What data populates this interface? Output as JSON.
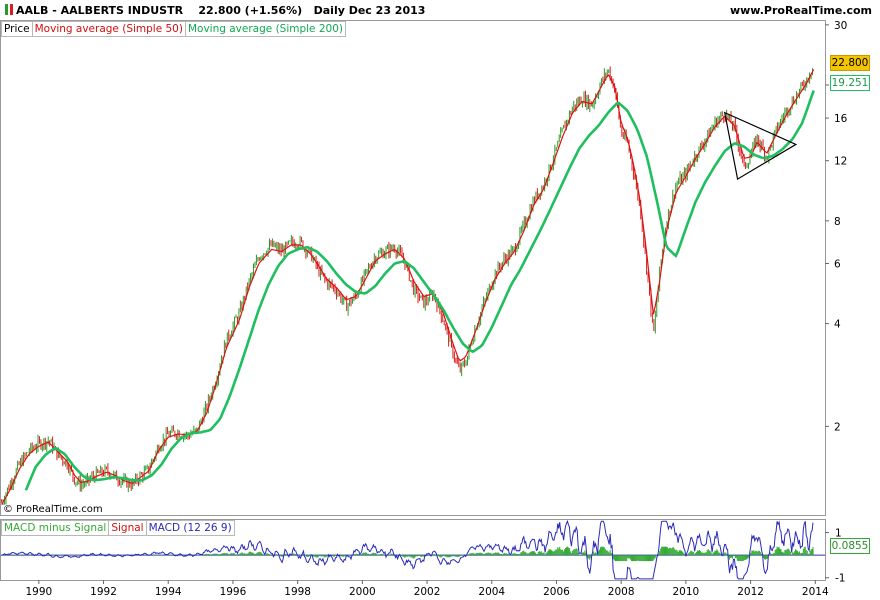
{
  "header": {
    "symbol_line": "AALB - AALBERTS INDUSTR",
    "last_price": "22.800 (+1.56%)",
    "period": "Daily  Dec 23 2013",
    "brand": "www.ProRealTime.com"
  },
  "legend": {
    "price": "Price",
    "ma50": "Moving average (Simple 50)",
    "ma200": "Moving average (Simple 200)"
  },
  "macd_legend": {
    "histogram": "MACD minus Signal",
    "signal": "Signal",
    "macd": "MACD (12 26 9)"
  },
  "copyright": "© ProRealTime.com",
  "price_tags": {
    "last": "22.800",
    "ma200": "19.251",
    "macd": "0.0855"
  },
  "colors": {
    "up": "#2a9a2a",
    "down": "#d62020",
    "ma50": "#e01010",
    "ma200": "#1fbf5f",
    "macd": "#2b2bb8",
    "hist": "#33aa33",
    "last_tag_bg": "#f5c400",
    "grid": "#cccccc"
  },
  "chart_data": [
    {
      "type": "line",
      "title": "AALB - AALBERTS INDUSTR",
      "y_scale": "log",
      "ylim": [
        1.1,
        31
      ],
      "xlim": [
        1988.8,
        2014.3
      ],
      "y_ticks": [
        30,
        20,
        16,
        12,
        8,
        6,
        4,
        2
      ],
      "x_ticks": [
        1990,
        1992,
        1994,
        1996,
        1998,
        2000,
        2002,
        2004,
        2006,
        2008,
        2010,
        2012,
        2014
      ],
      "series": [
        {
          "name": "Price",
          "x": [
            1988.85,
            1989.1,
            1989.4,
            1989.7,
            1990.0,
            1990.3,
            1990.6,
            1990.9,
            1991.1,
            1991.3,
            1991.5,
            1991.8,
            1992.1,
            1992.4,
            1992.6,
            1992.9,
            1993.1,
            1993.4,
            1993.7,
            1994.0,
            1994.3,
            1994.6,
            1994.9,
            1995.2,
            1995.5,
            1995.8,
            1996.2,
            1996.5,
            1996.8,
            1997.2,
            1997.5,
            1997.8,
            1998.1,
            1998.4,
            1998.7,
            1998.9,
            1999.2,
            1999.5,
            1999.8,
            2000.1,
            2000.4,
            2000.7,
            2001.0,
            2001.3,
            2001.6,
            2001.9,
            2002.2,
            2002.5,
            2002.8,
            2003.0,
            2003.2,
            2003.5,
            2003.8,
            2004.1,
            2004.4,
            2004.7,
            2005.0,
            2005.3,
            2005.6,
            2005.9,
            2006.2,
            2006.5,
            2006.8,
            2007.1,
            2007.4,
            2007.6,
            2007.8,
            2008.0,
            2008.2,
            2008.4,
            2008.6,
            2008.8,
            2009.0,
            2009.2,
            2009.4,
            2009.7,
            2010.0,
            2010.3,
            2010.6,
            2010.9,
            2011.2,
            2011.5,
            2011.8,
            2012.0,
            2012.2,
            2012.5,
            2012.8,
            2013.1,
            2013.4,
            2013.7,
            2013.95
          ],
          "values": [
            1.2,
            1.35,
            1.55,
            1.7,
            1.78,
            1.82,
            1.65,
            1.55,
            1.4,
            1.35,
            1.38,
            1.45,
            1.48,
            1.42,
            1.38,
            1.35,
            1.42,
            1.5,
            1.75,
            1.9,
            1.92,
            1.88,
            1.95,
            2.3,
            2.8,
            3.6,
            4.3,
            5.3,
            6.3,
            6.8,
            6.5,
            6.9,
            6.9,
            6.4,
            5.6,
            5.3,
            5.0,
            4.5,
            4.8,
            5.6,
            6.3,
            6.5,
            6.7,
            6.1,
            5.0,
            4.6,
            4.9,
            4.1,
            3.3,
            2.9,
            3.1,
            3.9,
            4.7,
            5.6,
            6.2,
            6.6,
            7.8,
            9.2,
            10.2,
            12.2,
            14.8,
            17.2,
            18.3,
            17.5,
            20.5,
            22.2,
            19.5,
            14.5,
            13.5,
            11.0,
            8.5,
            5.7,
            3.7,
            5.8,
            8.0,
            10.2,
            11.0,
            12.5,
            13.8,
            15.5,
            16.5,
            15.0,
            11.5,
            12.4,
            14.0,
            12.3,
            14.8,
            16.8,
            18.5,
            20.5,
            22.8
          ]
        },
        {
          "name": "Moving average (Simple 50)",
          "x": [
            1988.85,
            1989.1,
            1989.4,
            1989.7,
            1990.0,
            1990.3,
            1990.6,
            1990.9,
            1991.1,
            1991.3,
            1991.5,
            1991.8,
            1992.1,
            1992.4,
            1992.6,
            1992.9,
            1993.1,
            1993.4,
            1993.7,
            1994.0,
            1994.3,
            1994.6,
            1994.9,
            1995.2,
            1995.5,
            1995.8,
            1996.2,
            1996.5,
            1996.8,
            1997.2,
            1997.5,
            1997.8,
            1998.1,
            1998.4,
            1998.7,
            1998.9,
            1999.2,
            1999.5,
            1999.8,
            2000.1,
            2000.4,
            2000.7,
            2001.0,
            2001.3,
            2001.6,
            2001.9,
            2002.2,
            2002.5,
            2002.8,
            2003.0,
            2003.2,
            2003.5,
            2003.8,
            2004.1,
            2004.4,
            2004.7,
            2005.0,
            2005.3,
            2005.6,
            2005.9,
            2006.2,
            2006.5,
            2006.8,
            2007.1,
            2007.4,
            2007.6,
            2007.8,
            2008.0,
            2008.2,
            2008.4,
            2008.6,
            2008.8,
            2009.0,
            2009.2,
            2009.4,
            2009.7,
            2010.0,
            2010.3,
            2010.6,
            2010.9,
            2011.2,
            2011.5,
            2011.8,
            2012.0,
            2012.2,
            2012.5,
            2012.8,
            2013.1,
            2013.4,
            2013.7,
            2013.95
          ],
          "values": [
            1.18,
            1.3,
            1.5,
            1.66,
            1.75,
            1.8,
            1.68,
            1.57,
            1.44,
            1.37,
            1.38,
            1.43,
            1.47,
            1.43,
            1.39,
            1.36,
            1.41,
            1.48,
            1.7,
            1.86,
            1.9,
            1.89,
            1.94,
            2.2,
            2.7,
            3.4,
            4.1,
            5.1,
            6.0,
            6.6,
            6.5,
            6.8,
            6.8,
            6.4,
            5.8,
            5.4,
            5.1,
            4.7,
            4.8,
            5.4,
            6.1,
            6.4,
            6.6,
            6.2,
            5.3,
            4.8,
            4.9,
            4.3,
            3.5,
            3.1,
            3.2,
            3.8,
            4.6,
            5.4,
            6.0,
            6.5,
            7.5,
            8.9,
            9.9,
            11.8,
            14.2,
            16.6,
            17.9,
            17.6,
            19.9,
            21.5,
            19.8,
            15.5,
            13.9,
            11.5,
            9.0,
            6.3,
            4.2,
            5.4,
            7.5,
            9.7,
            10.8,
            12.2,
            13.5,
            15.1,
            16.2,
            15.2,
            12.2,
            12.3,
            13.6,
            12.6,
            14.4,
            16.3,
            18.1,
            20.0,
            22.2
          ]
        },
        {
          "name": "Moving average (Simple 200)",
          "x": [
            1989.6,
            1989.9,
            1990.2,
            1990.5,
            1990.8,
            1991.1,
            1991.4,
            1991.7,
            1992.0,
            1992.3,
            1992.6,
            1992.9,
            1993.2,
            1993.5,
            1993.8,
            1994.1,
            1994.4,
            1994.7,
            1995.0,
            1995.3,
            1995.6,
            1995.9,
            1996.2,
            1996.5,
            1996.8,
            1997.1,
            1997.4,
            1997.7,
            1998.0,
            1998.3,
            1998.6,
            1998.9,
            1999.2,
            1999.5,
            1999.8,
            2000.1,
            2000.4,
            2000.7,
            2001.0,
            2001.3,
            2001.6,
            2001.9,
            2002.2,
            2002.5,
            2002.8,
            2003.1,
            2003.4,
            2003.7,
            2004.0,
            2004.3,
            2004.6,
            2004.9,
            2005.2,
            2005.5,
            2005.8,
            2006.1,
            2006.4,
            2006.7,
            2007.0,
            2007.3,
            2007.6,
            2007.9,
            2008.2,
            2008.5,
            2008.8,
            2009.1,
            2009.4,
            2009.7,
            2010.0,
            2010.3,
            2010.6,
            2010.9,
            2011.2,
            2011.5,
            2011.8,
            2012.1,
            2012.4,
            2012.7,
            2013.0,
            2013.3,
            2013.6,
            2013.95
          ],
          "values": [
            1.3,
            1.52,
            1.65,
            1.73,
            1.66,
            1.52,
            1.42,
            1.39,
            1.4,
            1.42,
            1.41,
            1.39,
            1.39,
            1.44,
            1.55,
            1.72,
            1.85,
            1.91,
            1.92,
            1.95,
            2.1,
            2.45,
            2.95,
            3.6,
            4.4,
            5.2,
            5.9,
            6.4,
            6.6,
            6.7,
            6.5,
            6.1,
            5.6,
            5.2,
            4.95,
            4.9,
            5.15,
            5.6,
            6.0,
            6.1,
            5.8,
            5.3,
            4.85,
            4.4,
            3.9,
            3.5,
            3.3,
            3.45,
            3.9,
            4.5,
            5.2,
            5.8,
            6.6,
            7.5,
            8.6,
            9.9,
            11.4,
            13.0,
            14.2,
            15.2,
            16.6,
            17.8,
            16.8,
            14.8,
            12.3,
            9.2,
            6.7,
            6.3,
            7.6,
            9.1,
            10.4,
            11.6,
            12.8,
            13.5,
            13.2,
            12.5,
            12.2,
            12.4,
            13.0,
            13.9,
            15.5,
            19.251
          ]
        }
      ],
      "annotations": [
        {
          "type": "triangle",
          "points": [
            [
              2011.2,
              16.6
            ],
            [
              2011.6,
              10.6
            ],
            [
              2013.4,
              13.4
            ]
          ]
        }
      ]
    },
    {
      "type": "line",
      "title": "MACD (12 26 9)",
      "ylim": [
        -1.1,
        1.6
      ],
      "y_ticks": [
        1,
        0.0855,
        -1
      ],
      "series": [
        {
          "name": "MACD (12 26 9)",
          "note": "oscillates near zero; wide swings 2006-2013",
          "last": 0.0855
        },
        {
          "name": "Signal",
          "last": 0.0855
        },
        {
          "name": "MACD minus Signal",
          "last": 0.0855
        }
      ]
    }
  ]
}
